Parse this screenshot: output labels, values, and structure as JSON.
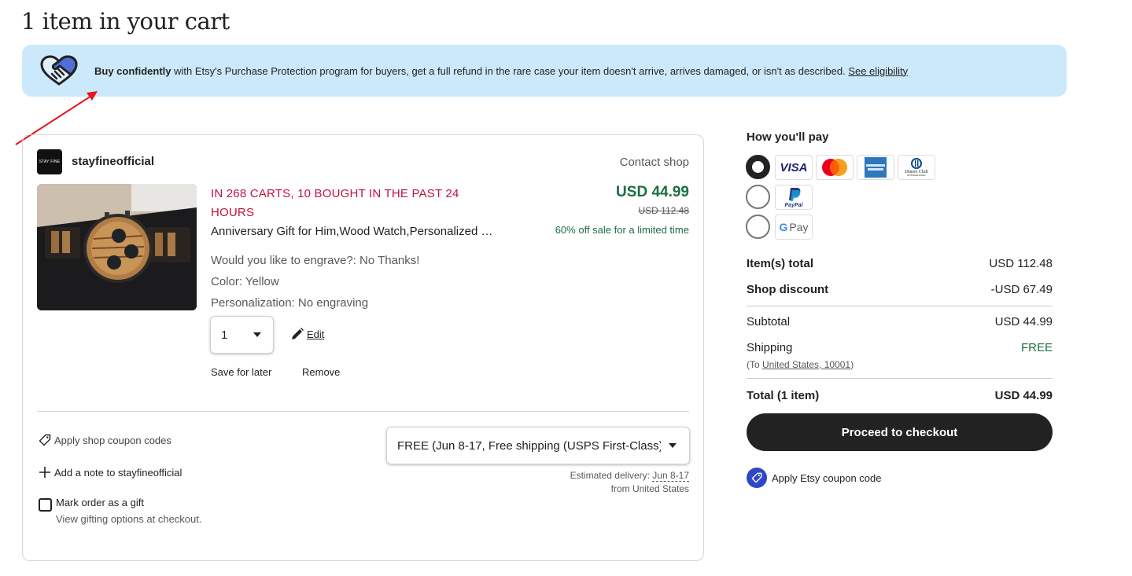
{
  "page": {
    "title": "1 item in your cart"
  },
  "banner": {
    "bold": "Buy confidently",
    "text": " with Etsy's Purchase Protection program for buyers, get a full refund in the rare case your item doesn't arrive, arrives damaged, or isn't as described. ",
    "link": "See eligibility",
    "bg_color": "#cce9fb"
  },
  "shop": {
    "logo_text": "STAY FINE",
    "name": "stayfineofficial",
    "contact_label": "Contact shop"
  },
  "item": {
    "urgency": "IN 268 CARTS, 10 BOUGHT IN THE PAST 24 HOURS",
    "title": "Anniversary Gift for Him,Wood Watch,Personalized Watch",
    "variations": [
      "Would you like to engrave?: No Thanks!",
      "Color: Yellow",
      "Personalization: No engraving"
    ],
    "price": "USD 44.99",
    "original_price": "USD 112.48",
    "sale_note": "60% off sale for a limited time",
    "quantity": "1",
    "edit_label": "Edit",
    "save_for_later_label": "Save for later",
    "remove_label": "Remove",
    "image_alt": "Wooden chronograph watch"
  },
  "shop_footer": {
    "coupon_label": "Apply shop coupon codes",
    "note_label": "Add a note to stayfineofficial",
    "gift_label": "Mark order as a gift",
    "gift_sub": "View gifting options at checkout.",
    "gift_checked": false,
    "shipping_selected": "FREE (Jun 8-17, Free shipping (USPS First-Class))",
    "est_prefix": "Estimated delivery: ",
    "est_date": "Jun 8-17",
    "est_from": "from United States"
  },
  "payment": {
    "title": "How you'll pay",
    "options": [
      {
        "name": "cards",
        "checked": true,
        "methods": [
          "VISA",
          "Mastercard",
          "American Express",
          "Diners Club"
        ]
      },
      {
        "name": "paypal",
        "checked": false,
        "methods": [
          "PayPal"
        ]
      },
      {
        "name": "googlepay",
        "checked": false,
        "methods": [
          "G Pay"
        ]
      }
    ]
  },
  "summary": {
    "items_total_label": "Item(s) total",
    "items_total": "USD 112.48",
    "discount_label": "Shop discount",
    "discount": "-USD 67.49",
    "subtotal_label": "Subtotal",
    "subtotal": "USD 44.99",
    "shipping_label": "Shipping",
    "shipping": "FREE",
    "shipping_to_prefix": "(To ",
    "shipping_to": "United States, 10001",
    "shipping_to_suffix": ")",
    "total_label": "Total (1 item)",
    "total": "USD 44.99",
    "checkout_label": "Proceed to checkout",
    "etsy_coupon_label": "Apply Etsy coupon code"
  },
  "colors": {
    "price_green": "#1b6e43",
    "urgency_red": "#c3103e",
    "checkout_bg": "#222222",
    "coupon_blue": "#2f46c7",
    "annotation_arrow": "#e8141b"
  }
}
